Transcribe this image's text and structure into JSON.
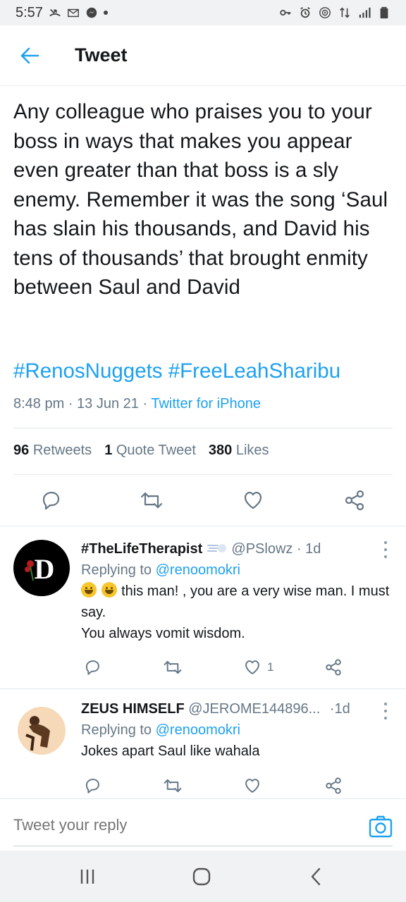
{
  "status_bar": {
    "time": "5:57"
  },
  "app_bar": {
    "title": "Tweet"
  },
  "tweet": {
    "text": "Any colleague who praises you to your boss in ways that makes you appear even greater than that boss is a sly enemy. Remember it was the song ‘Saul has slain his thousands, and David his tens of thousands’ that brought enmity between Saul and David",
    "hashtags": "#RenosNuggets #FreeLeahSharibu",
    "time": "8:48 pm",
    "date": "13 Jun 21",
    "source": "Twitter for iPhone",
    "retweets_count": "96",
    "retweets_label": "Retweets",
    "quotes_count": "1",
    "quotes_label": "Quote Tweet",
    "likes_count": "380",
    "likes_label": "Likes"
  },
  "replies": [
    {
      "name": "#TheLifeTherapist",
      "handle": "@PSlowz",
      "time": "1d",
      "replying_prefix": "Replying to",
      "replying_to": "@renoomokri",
      "text_line1": "this man! , you are a very wise man. I must say.",
      "text_line2": "You always vomit wisdom.",
      "like_count": "1",
      "avatar_letter": "D"
    },
    {
      "name": "ZEUS HIMSELF",
      "handle": "@JEROME144896...",
      "time": "1d",
      "replying_prefix": "Replying to",
      "replying_to": "@renoomokri",
      "text": "Jokes apart Saul like wahala"
    }
  ],
  "compose": {
    "placeholder": "Tweet your reply"
  },
  "colors": {
    "accent": "#1da1f2",
    "muted": "#657786",
    "text": "#14171a"
  }
}
